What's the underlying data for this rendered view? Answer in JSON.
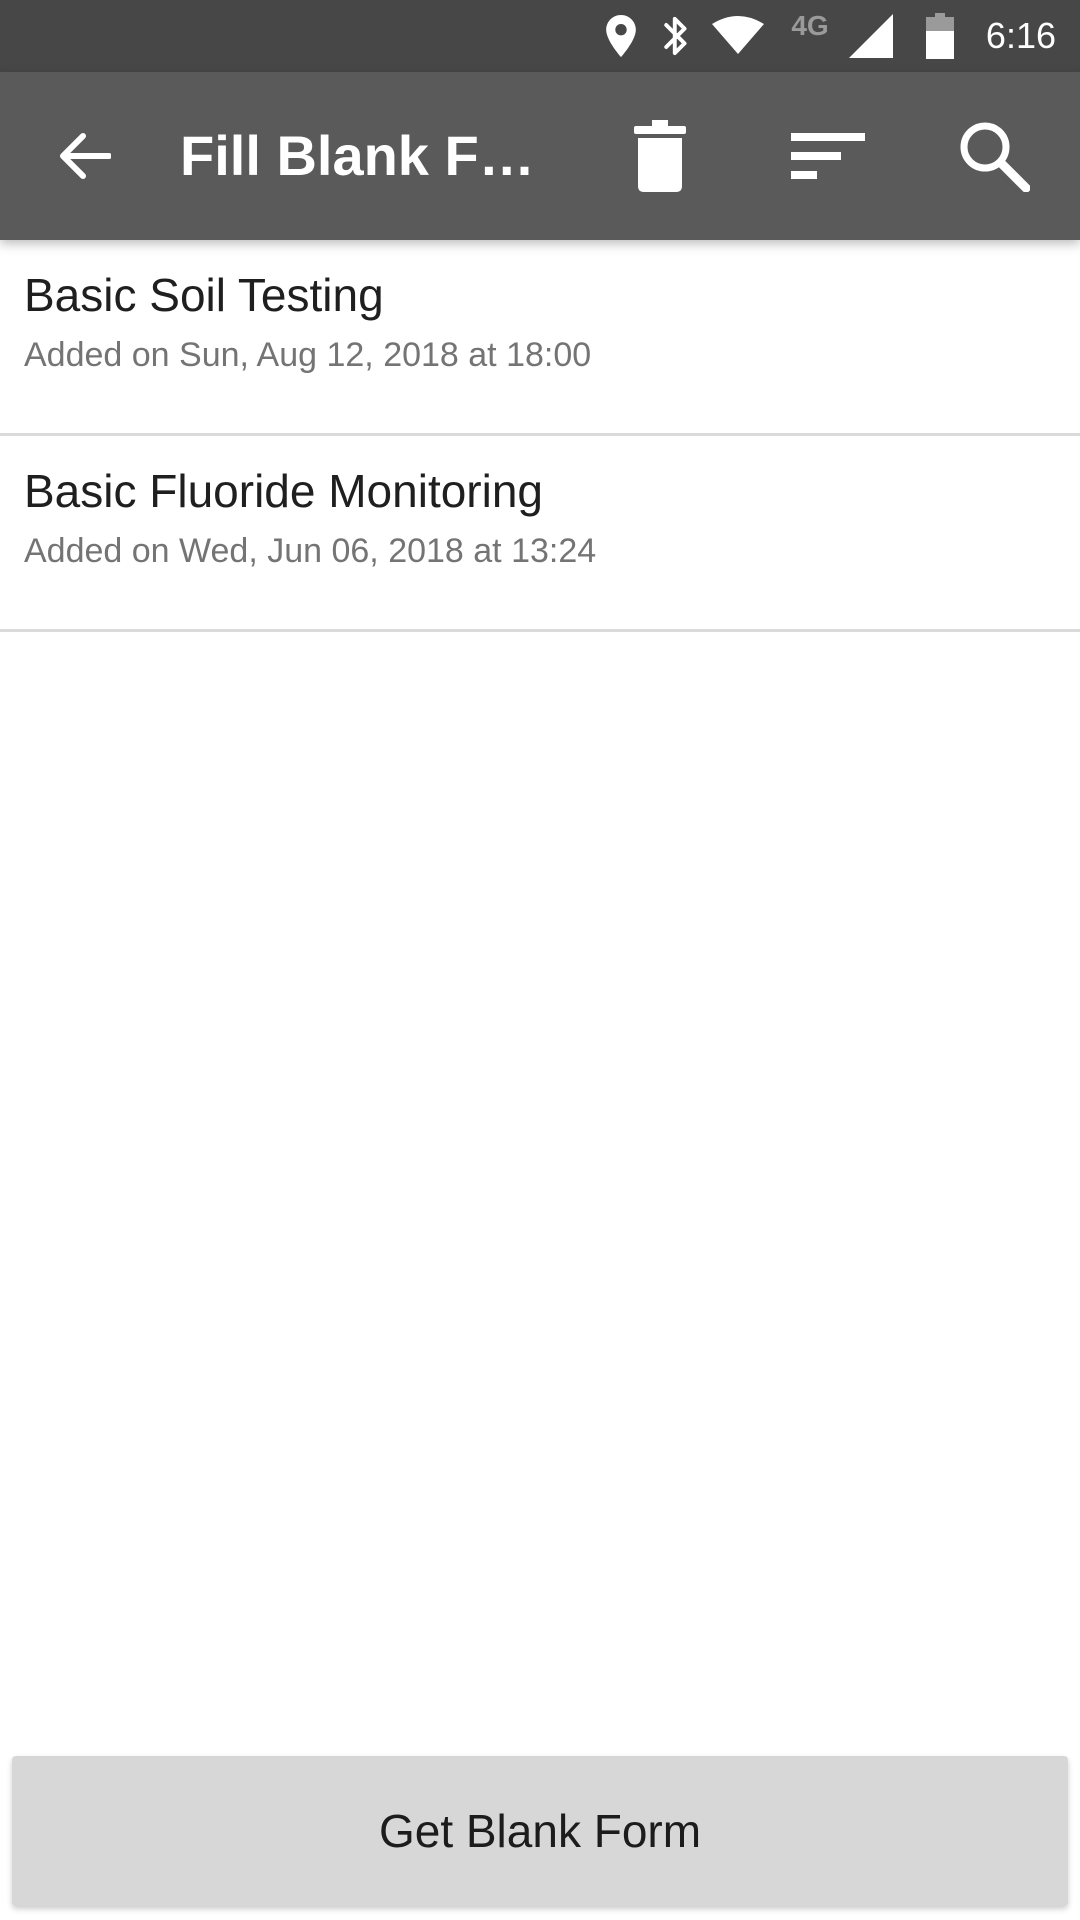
{
  "status_bar": {
    "time": "6:16",
    "network_label": "4G",
    "icons": [
      "location-icon",
      "bluetooth-icon",
      "wifi-icon",
      "cell-signal-icon",
      "battery-icon"
    ]
  },
  "app_bar": {
    "title": "Fill Blank Fo…",
    "back_icon": "arrow-back-icon",
    "delete_icon": "trash-icon",
    "sort_icon": "sort-icon",
    "search_icon": "search-icon"
  },
  "forms": [
    {
      "title": "Basic Soil Testing",
      "subtitle": "Added on Sun, Aug 12, 2018 at 18:00"
    },
    {
      "title": "Basic Fluoride Monitoring",
      "subtitle": "Added on Wed, Jun 06, 2018 at 13:24"
    }
  ],
  "bottom": {
    "get_blank_form_label": "Get Blank Form"
  },
  "colors": {
    "status_bar": "#474747",
    "app_bar": "#5a5a5a",
    "divider": "#dadada",
    "button": "#d7d7d7"
  }
}
